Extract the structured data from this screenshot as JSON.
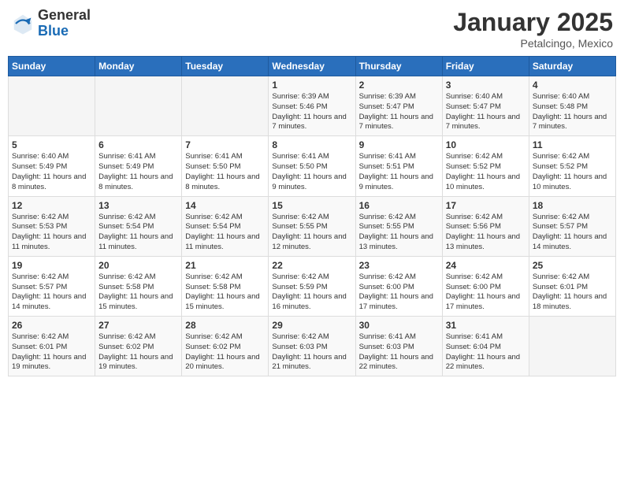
{
  "header": {
    "logo_general": "General",
    "logo_blue": "Blue",
    "month_title": "January 2025",
    "location": "Petalcingo, Mexico"
  },
  "days_of_week": [
    "Sunday",
    "Monday",
    "Tuesday",
    "Wednesday",
    "Thursday",
    "Friday",
    "Saturday"
  ],
  "weeks": [
    [
      {
        "day": "",
        "info": ""
      },
      {
        "day": "",
        "info": ""
      },
      {
        "day": "",
        "info": ""
      },
      {
        "day": "1",
        "info": "Sunrise: 6:39 AM\nSunset: 5:46 PM\nDaylight: 11 hours and 7 minutes."
      },
      {
        "day": "2",
        "info": "Sunrise: 6:39 AM\nSunset: 5:47 PM\nDaylight: 11 hours and 7 minutes."
      },
      {
        "day": "3",
        "info": "Sunrise: 6:40 AM\nSunset: 5:47 PM\nDaylight: 11 hours and 7 minutes."
      },
      {
        "day": "4",
        "info": "Sunrise: 6:40 AM\nSunset: 5:48 PM\nDaylight: 11 hours and 7 minutes."
      }
    ],
    [
      {
        "day": "5",
        "info": "Sunrise: 6:40 AM\nSunset: 5:49 PM\nDaylight: 11 hours and 8 minutes."
      },
      {
        "day": "6",
        "info": "Sunrise: 6:41 AM\nSunset: 5:49 PM\nDaylight: 11 hours and 8 minutes."
      },
      {
        "day": "7",
        "info": "Sunrise: 6:41 AM\nSunset: 5:50 PM\nDaylight: 11 hours and 8 minutes."
      },
      {
        "day": "8",
        "info": "Sunrise: 6:41 AM\nSunset: 5:50 PM\nDaylight: 11 hours and 9 minutes."
      },
      {
        "day": "9",
        "info": "Sunrise: 6:41 AM\nSunset: 5:51 PM\nDaylight: 11 hours and 9 minutes."
      },
      {
        "day": "10",
        "info": "Sunrise: 6:42 AM\nSunset: 5:52 PM\nDaylight: 11 hours and 10 minutes."
      },
      {
        "day": "11",
        "info": "Sunrise: 6:42 AM\nSunset: 5:52 PM\nDaylight: 11 hours and 10 minutes."
      }
    ],
    [
      {
        "day": "12",
        "info": "Sunrise: 6:42 AM\nSunset: 5:53 PM\nDaylight: 11 hours and 11 minutes."
      },
      {
        "day": "13",
        "info": "Sunrise: 6:42 AM\nSunset: 5:54 PM\nDaylight: 11 hours and 11 minutes."
      },
      {
        "day": "14",
        "info": "Sunrise: 6:42 AM\nSunset: 5:54 PM\nDaylight: 11 hours and 11 minutes."
      },
      {
        "day": "15",
        "info": "Sunrise: 6:42 AM\nSunset: 5:55 PM\nDaylight: 11 hours and 12 minutes."
      },
      {
        "day": "16",
        "info": "Sunrise: 6:42 AM\nSunset: 5:55 PM\nDaylight: 11 hours and 13 minutes."
      },
      {
        "day": "17",
        "info": "Sunrise: 6:42 AM\nSunset: 5:56 PM\nDaylight: 11 hours and 13 minutes."
      },
      {
        "day": "18",
        "info": "Sunrise: 6:42 AM\nSunset: 5:57 PM\nDaylight: 11 hours and 14 minutes."
      }
    ],
    [
      {
        "day": "19",
        "info": "Sunrise: 6:42 AM\nSunset: 5:57 PM\nDaylight: 11 hours and 14 minutes."
      },
      {
        "day": "20",
        "info": "Sunrise: 6:42 AM\nSunset: 5:58 PM\nDaylight: 11 hours and 15 minutes."
      },
      {
        "day": "21",
        "info": "Sunrise: 6:42 AM\nSunset: 5:58 PM\nDaylight: 11 hours and 15 minutes."
      },
      {
        "day": "22",
        "info": "Sunrise: 6:42 AM\nSunset: 5:59 PM\nDaylight: 11 hours and 16 minutes."
      },
      {
        "day": "23",
        "info": "Sunrise: 6:42 AM\nSunset: 6:00 PM\nDaylight: 11 hours and 17 minutes."
      },
      {
        "day": "24",
        "info": "Sunrise: 6:42 AM\nSunset: 6:00 PM\nDaylight: 11 hours and 17 minutes."
      },
      {
        "day": "25",
        "info": "Sunrise: 6:42 AM\nSunset: 6:01 PM\nDaylight: 11 hours and 18 minutes."
      }
    ],
    [
      {
        "day": "26",
        "info": "Sunrise: 6:42 AM\nSunset: 6:01 PM\nDaylight: 11 hours and 19 minutes."
      },
      {
        "day": "27",
        "info": "Sunrise: 6:42 AM\nSunset: 6:02 PM\nDaylight: 11 hours and 19 minutes."
      },
      {
        "day": "28",
        "info": "Sunrise: 6:42 AM\nSunset: 6:02 PM\nDaylight: 11 hours and 20 minutes."
      },
      {
        "day": "29",
        "info": "Sunrise: 6:42 AM\nSunset: 6:03 PM\nDaylight: 11 hours and 21 minutes."
      },
      {
        "day": "30",
        "info": "Sunrise: 6:41 AM\nSunset: 6:03 PM\nDaylight: 11 hours and 22 minutes."
      },
      {
        "day": "31",
        "info": "Sunrise: 6:41 AM\nSunset: 6:04 PM\nDaylight: 11 hours and 22 minutes."
      },
      {
        "day": "",
        "info": ""
      }
    ]
  ]
}
